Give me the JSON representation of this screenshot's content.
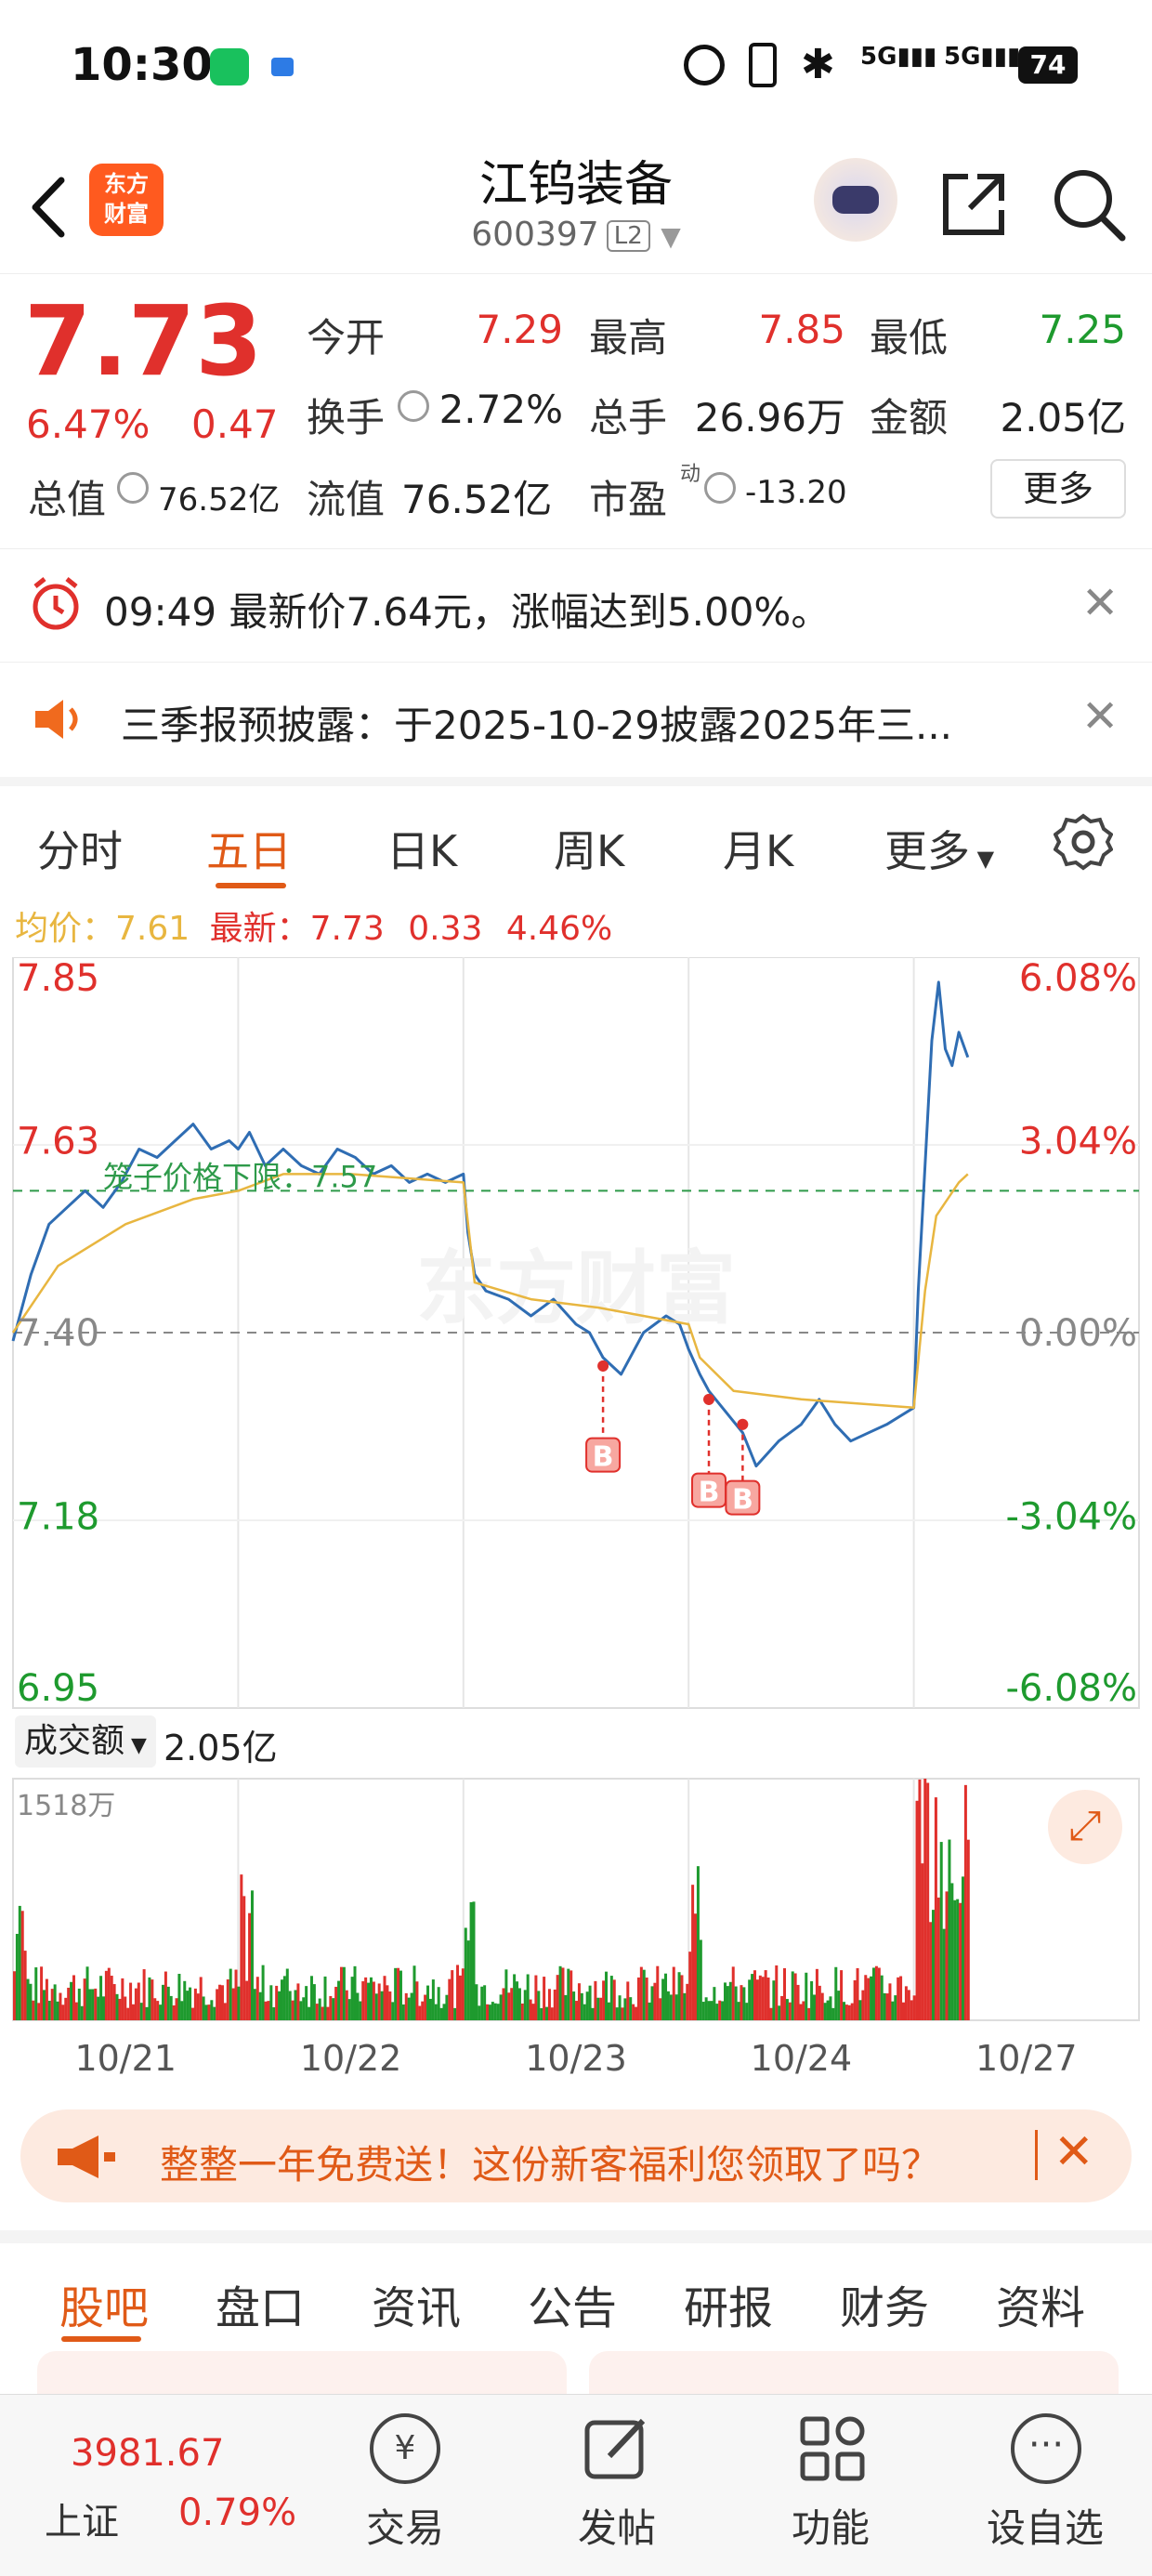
{
  "status_bar": {
    "time": "10:30",
    "battery": "74",
    "network": "5G"
  },
  "header": {
    "logo_line1": "东方",
    "logo_line2": "财富",
    "stock_name": "江钨装备",
    "stock_code": "600397",
    "level_badge": "L2"
  },
  "quote": {
    "price": "7.73",
    "change_pct": "6.47%",
    "change_amt": "0.47",
    "open_label": "今开",
    "open_value": "7.29",
    "high_label": "最高",
    "high_value": "7.85",
    "low_label": "最低",
    "low_value": "7.25",
    "turnover_label": "换手",
    "turnover_value": "2.72%",
    "volume_label": "总手",
    "volume_value": "26.96万",
    "amount_label": "金额",
    "amount_value": "2.05亿",
    "mktcap_label": "总值",
    "mktcap_value": "76.52亿",
    "float_label": "流值",
    "float_value": "76.52亿",
    "pe_label": "市盈",
    "pe_sup": "动",
    "pe_value": "-13.20",
    "more_button": "更多"
  },
  "notices": [
    {
      "icon": "alarm-clock-icon",
      "text": "09:49 最新价7.64元，涨幅达到5.00%。"
    },
    {
      "icon": "speaker-icon",
      "text": "三季报预披露：于2025-10-29披露2025年三..."
    }
  ],
  "chart_tabs": [
    "分时",
    "五日",
    "日K",
    "周K",
    "月K",
    "更多"
  ],
  "active_chart_tab": "五日",
  "avg_info": {
    "avg_label": "均价：",
    "avg_value": "7.61",
    "latest_label": "最新：",
    "latest_value": "7.73",
    "latest_change": "0.33",
    "latest_pct": "4.46%"
  },
  "chart_data": {
    "type": "line",
    "title": "",
    "x": [
      "10/21",
      "10/22",
      "10/23",
      "10/24",
      "10/27"
    ],
    "y_left_ticks": [
      "7.85",
      "7.63",
      "7.40",
      "7.18",
      "6.95"
    ],
    "y_right_ticks": [
      "6.08%",
      "3.04%",
      "0.00%",
      "-3.04%",
      "-6.08%"
    ],
    "ylim": [
      6.95,
      7.85
    ],
    "reference_close": 7.4,
    "cage_line": {
      "label": "笼子价格下限：7.57",
      "value": 7.57
    },
    "buy_marker_label": "B",
    "buy_markers": [
      {
        "day": 2.62,
        "price": 7.36
      },
      {
        "day": 3.09,
        "price": 7.32
      },
      {
        "day": 3.24,
        "price": 7.29
      }
    ],
    "series": [
      {
        "name": "price",
        "color": "#2f6db3",
        "points": [
          [
            0.0,
            7.39
          ],
          [
            0.08,
            7.47
          ],
          [
            0.16,
            7.53
          ],
          [
            0.24,
            7.55
          ],
          [
            0.32,
            7.57
          ],
          [
            0.4,
            7.55
          ],
          [
            0.48,
            7.58
          ],
          [
            0.56,
            7.62
          ],
          [
            0.64,
            7.61
          ],
          [
            0.72,
            7.63
          ],
          [
            0.8,
            7.65
          ],
          [
            0.88,
            7.62
          ],
          [
            0.96,
            7.63
          ],
          [
            1.0,
            7.62
          ],
          [
            1.05,
            7.64
          ],
          [
            1.12,
            7.6
          ],
          [
            1.2,
            7.62
          ],
          [
            1.28,
            7.6
          ],
          [
            1.36,
            7.59
          ],
          [
            1.44,
            7.62
          ],
          [
            1.52,
            7.61
          ],
          [
            1.6,
            7.59
          ],
          [
            1.68,
            7.6
          ],
          [
            1.76,
            7.58
          ],
          [
            1.84,
            7.59
          ],
          [
            1.92,
            7.58
          ],
          [
            2.0,
            7.59
          ],
          [
            2.02,
            7.52
          ],
          [
            2.05,
            7.47
          ],
          [
            2.1,
            7.45
          ],
          [
            2.2,
            7.44
          ],
          [
            2.3,
            7.42
          ],
          [
            2.4,
            7.44
          ],
          [
            2.5,
            7.41
          ],
          [
            2.56,
            7.4
          ],
          [
            2.62,
            7.37
          ],
          [
            2.7,
            7.35
          ],
          [
            2.8,
            7.4
          ],
          [
            2.9,
            7.42
          ],
          [
            2.96,
            7.41
          ],
          [
            3.0,
            7.38
          ],
          [
            3.05,
            7.35
          ],
          [
            3.09,
            7.33
          ],
          [
            3.15,
            7.31
          ],
          [
            3.24,
            7.28
          ],
          [
            3.3,
            7.24
          ],
          [
            3.4,
            7.27
          ],
          [
            3.5,
            7.29
          ],
          [
            3.58,
            7.32
          ],
          [
            3.65,
            7.29
          ],
          [
            3.72,
            7.27
          ],
          [
            3.8,
            7.28
          ],
          [
            3.88,
            7.29
          ],
          [
            4.0,
            7.31
          ],
          [
            4.02,
            7.45
          ],
          [
            4.05,
            7.6
          ],
          [
            4.08,
            7.75
          ],
          [
            4.11,
            7.82
          ],
          [
            4.14,
            7.74
          ],
          [
            4.17,
            7.72
          ],
          [
            4.2,
            7.76
          ],
          [
            4.24,
            7.73
          ]
        ]
      },
      {
        "name": "average",
        "color": "#e8b640",
        "points": [
          [
            0.0,
            7.4
          ],
          [
            0.2,
            7.48
          ],
          [
            0.5,
            7.53
          ],
          [
            0.8,
            7.56
          ],
          [
            1.0,
            7.57
          ],
          [
            1.2,
            7.59
          ],
          [
            1.5,
            7.59
          ],
          [
            2.0,
            7.58
          ],
          [
            2.05,
            7.46
          ],
          [
            2.3,
            7.44
          ],
          [
            2.6,
            7.43
          ],
          [
            3.0,
            7.41
          ],
          [
            3.05,
            7.37
          ],
          [
            3.2,
            7.33
          ],
          [
            3.5,
            7.32
          ],
          [
            4.0,
            7.31
          ],
          [
            4.05,
            7.45
          ],
          [
            4.1,
            7.54
          ],
          [
            4.2,
            7.58
          ],
          [
            4.24,
            7.59
          ]
        ]
      }
    ]
  },
  "volume_chart": {
    "label": "成交额",
    "total": "2.05亿",
    "max_label": "1518万",
    "x_labels": [
      "10/21",
      "10/22",
      "10/23",
      "10/24",
      "10/27"
    ]
  },
  "promo": {
    "text": "整整一年免费送！这份新客福利您领取了吗？"
  },
  "sub_tabs": [
    "股吧",
    "盘口",
    "资讯",
    "公告",
    "研报",
    "财务",
    "资料"
  ],
  "active_sub_tab": "股吧",
  "bottom_nav": {
    "index_value": "3981.67",
    "index_name": "上证",
    "index_pct": "0.79%",
    "items": [
      "交易",
      "发帖",
      "功能",
      "设自选"
    ]
  },
  "colors": {
    "up": "#e0302c",
    "down": "#1e9a2e",
    "accent": "#e05a17",
    "price_line": "#2f6db3",
    "avg_line": "#e8b640"
  }
}
